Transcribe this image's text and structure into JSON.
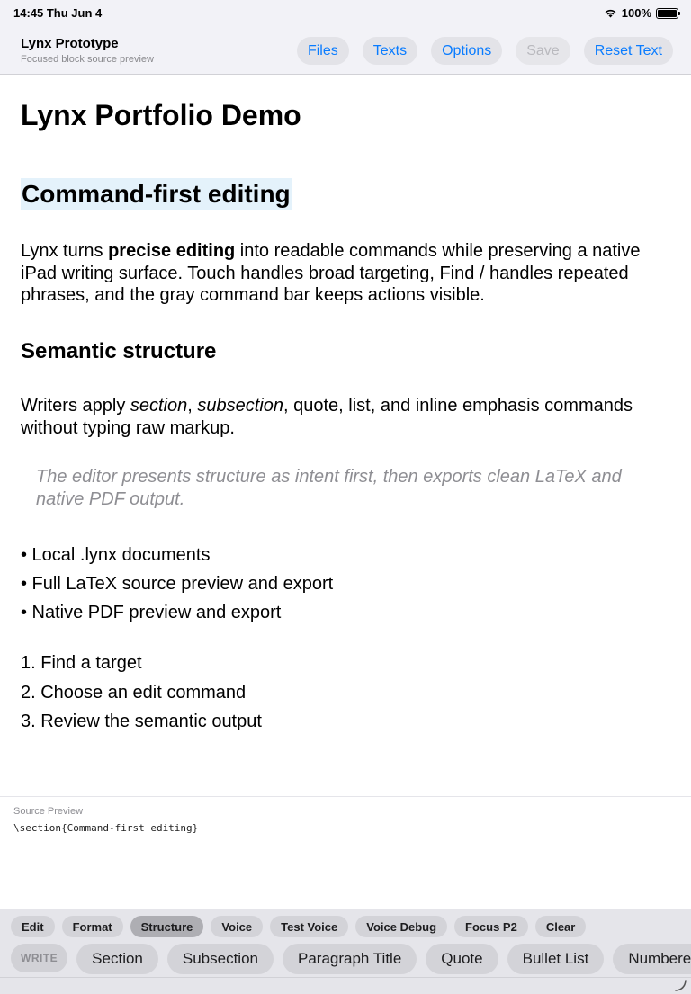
{
  "status_bar": {
    "time_date": "14:45  Thu Jun 4",
    "battery": "100%",
    "battery_level": 1.0
  },
  "nav": {
    "title": "Lynx Prototype",
    "subtitle": "Focused block source preview",
    "buttons": [
      "Files",
      "Texts",
      "Options",
      "Save",
      "Reset Text"
    ]
  },
  "document": {
    "title": "Lynx Portfolio Demo",
    "section": "Command-first editing",
    "para1": {
      "before": "Lynx turns ",
      "bold": "precise editing",
      "after": " into readable commands while preserving a native iPad writing surface. Touch handles broad targeting, Find / handles repeated phrases, and the gray command bar keeps actions visible."
    },
    "subsection": "Semantic structure",
    "para2": {
      "before": "Writers apply ",
      "em1": "section",
      "sep": ", ",
      "em2": "subsection",
      "after": ", quote, list, and inline emphasis commands without typing raw markup."
    },
    "quote": "The editor presents structure as intent first, then exports clean LaTeX and native PDF output.",
    "bullets": [
      "• Local .lynx documents",
      "• Full LaTeX source preview and export",
      "• Native PDF preview and export"
    ],
    "numbered": [
      "1. Find a target",
      "2. Choose an edit command",
      "3. Review the semantic output"
    ]
  },
  "source_preview": {
    "label": "Source Preview",
    "code": "\\section{Command-first editing}"
  },
  "command_bar": {
    "tabs": [
      "Edit",
      "Format",
      "Structure",
      "Voice",
      "Test Voice",
      "Voice Debug",
      "Focus P2",
      "Clear"
    ],
    "active_tab": "Structure",
    "mode": "WRITE",
    "commands": [
      "Section",
      "Subsection",
      "Paragraph Title",
      "Quote",
      "Bullet List",
      "Numbered List"
    ]
  }
}
